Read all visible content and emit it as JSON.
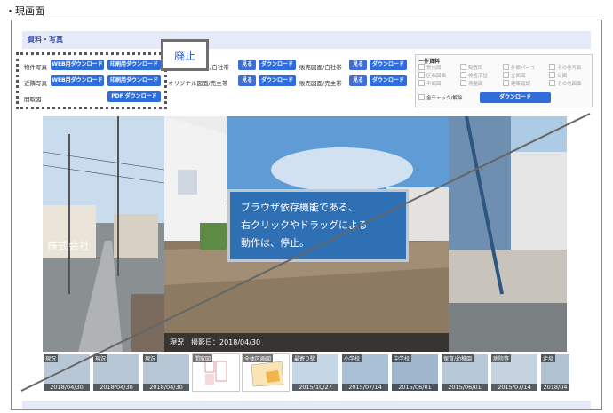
{
  "caption": "・現画面",
  "section_title": "資料・写真",
  "deprecated_label": "廃止",
  "rows": {
    "bukken": {
      "label": "物件写真",
      "web_btn": "WEB用ダウンロード",
      "print_btn": "印刷用ダウンロード"
    },
    "kinrin": {
      "label": "近隣写真",
      "web_btn": "WEB用ダウンロード",
      "print_btn": "印刷用ダウンロード"
    },
    "madori": {
      "label": "間取図",
      "pdf_btn": "PDF ダウンロード"
    }
  },
  "mid": {
    "row1_label": "/白社帯",
    "row2_label": "オリジナル図面/売主帯",
    "view_btn": "見る",
    "dl_btn": "ダウンロード"
  },
  "right": {
    "row1_label": "販売図面/白社帯",
    "row2_label": "販売図面/売主帯",
    "view_btn": "見る",
    "dl_btn": "ダウンロード"
  },
  "ichi": {
    "title": "一件資料",
    "items": [
      "案内図",
      "配置図",
      "外観パース",
      "その他写真",
      "区画図面",
      "検査済証",
      "立面図",
      "公図",
      "平面図",
      "測量図",
      "建築確認",
      "その他図面"
    ],
    "select_all": "全チェック/解除",
    "download": "ダウンロード"
  },
  "photo": {
    "caption": "現況　撮影日：2018/04/30",
    "watermark": "株式会社"
  },
  "tooltip": {
    "line1": "ブラウザ依存機能である、",
    "line2": "右クリックやドラッグによる",
    "line3": "動作は、停止。"
  },
  "thumbs": [
    {
      "label": "現況",
      "date": "2018/04/30"
    },
    {
      "label": "現況",
      "date": "2018/04/30"
    },
    {
      "label": "現況",
      "date": "2018/04/30"
    },
    {
      "label": "間取図",
      "date": ""
    },
    {
      "label": "全体区画図",
      "date": ""
    },
    {
      "label": "最寄り駅",
      "date": "2015/10/27"
    },
    {
      "label": "小学校",
      "date": "2015/07/14"
    },
    {
      "label": "中学校",
      "date": "2015/06/01"
    },
    {
      "label": "保育/幼稚園",
      "date": "2015/06/01"
    },
    {
      "label": "病院等",
      "date": "2015/07/14"
    },
    {
      "label": "走培",
      "date": "2018/04"
    }
  ],
  "colors": {
    "accent": "#2f6ddc",
    "tooltip": "#2f6fb4",
    "section_bg": "#e6e9f7"
  }
}
